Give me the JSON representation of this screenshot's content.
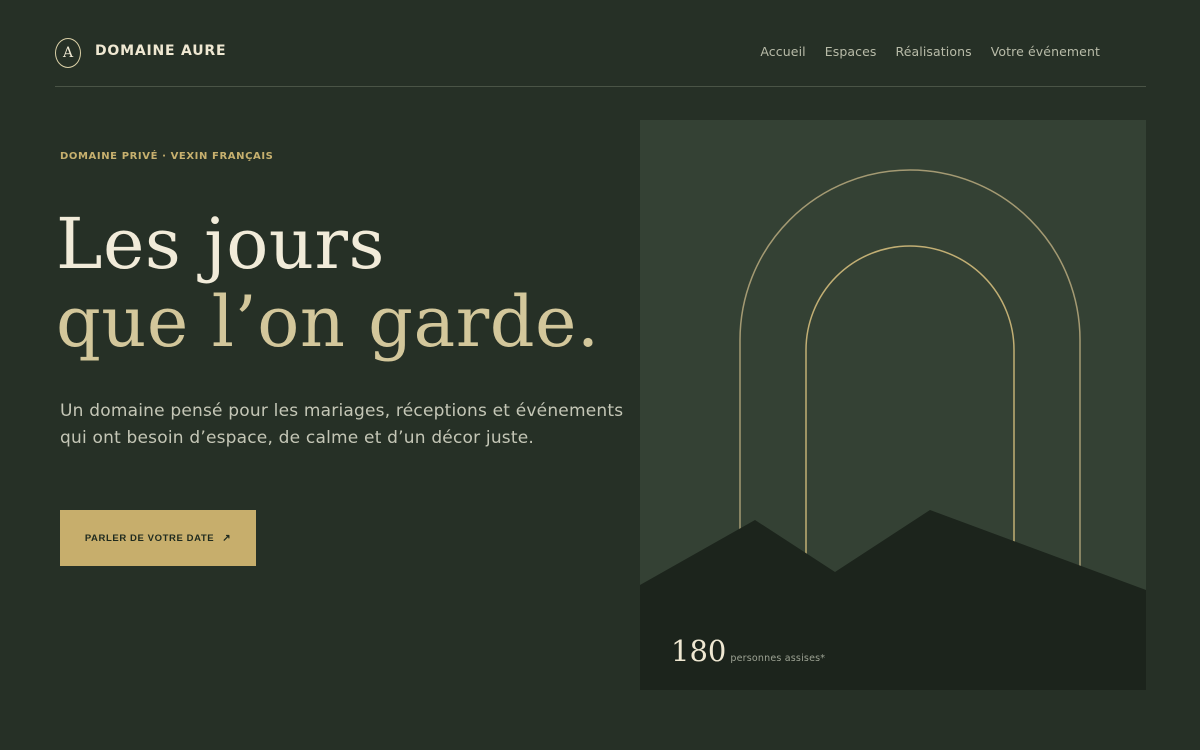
{
  "brand": {
    "logo_letter": "A",
    "name": "DOMAINE AURE"
  },
  "nav": {
    "items": [
      "Accueil",
      "Espaces",
      "Réalisations",
      "Votre événement"
    ]
  },
  "hero": {
    "kicker": "DOMAINE PRIVÉ · VEXIN FRANÇAIS",
    "title_line1": "Les jours",
    "title_line2": "que l’on garde.",
    "subtitle_line1": "Un domaine pensé pour les mariages, réceptions et événements",
    "subtitle_line2": "qui ont besoin d’espace, de calme et d’un décor juste.",
    "cta_label": "PARLER DE VOTRE DATE",
    "cta_arrow": "↗"
  },
  "visual": {
    "capacity_number": "180",
    "capacity_label": "personnes assises*"
  },
  "colors": {
    "background": "#263026",
    "panel": "#344134",
    "accent_gold": "#c7ae6c",
    "title_cream": "#f1ebd9",
    "title_gold": "#d3c79b",
    "hills": "#1c241c"
  },
  "icons": {
    "cta_icon": "arrow-up-right-icon",
    "logo_icon": "monogram-circle-icon"
  }
}
